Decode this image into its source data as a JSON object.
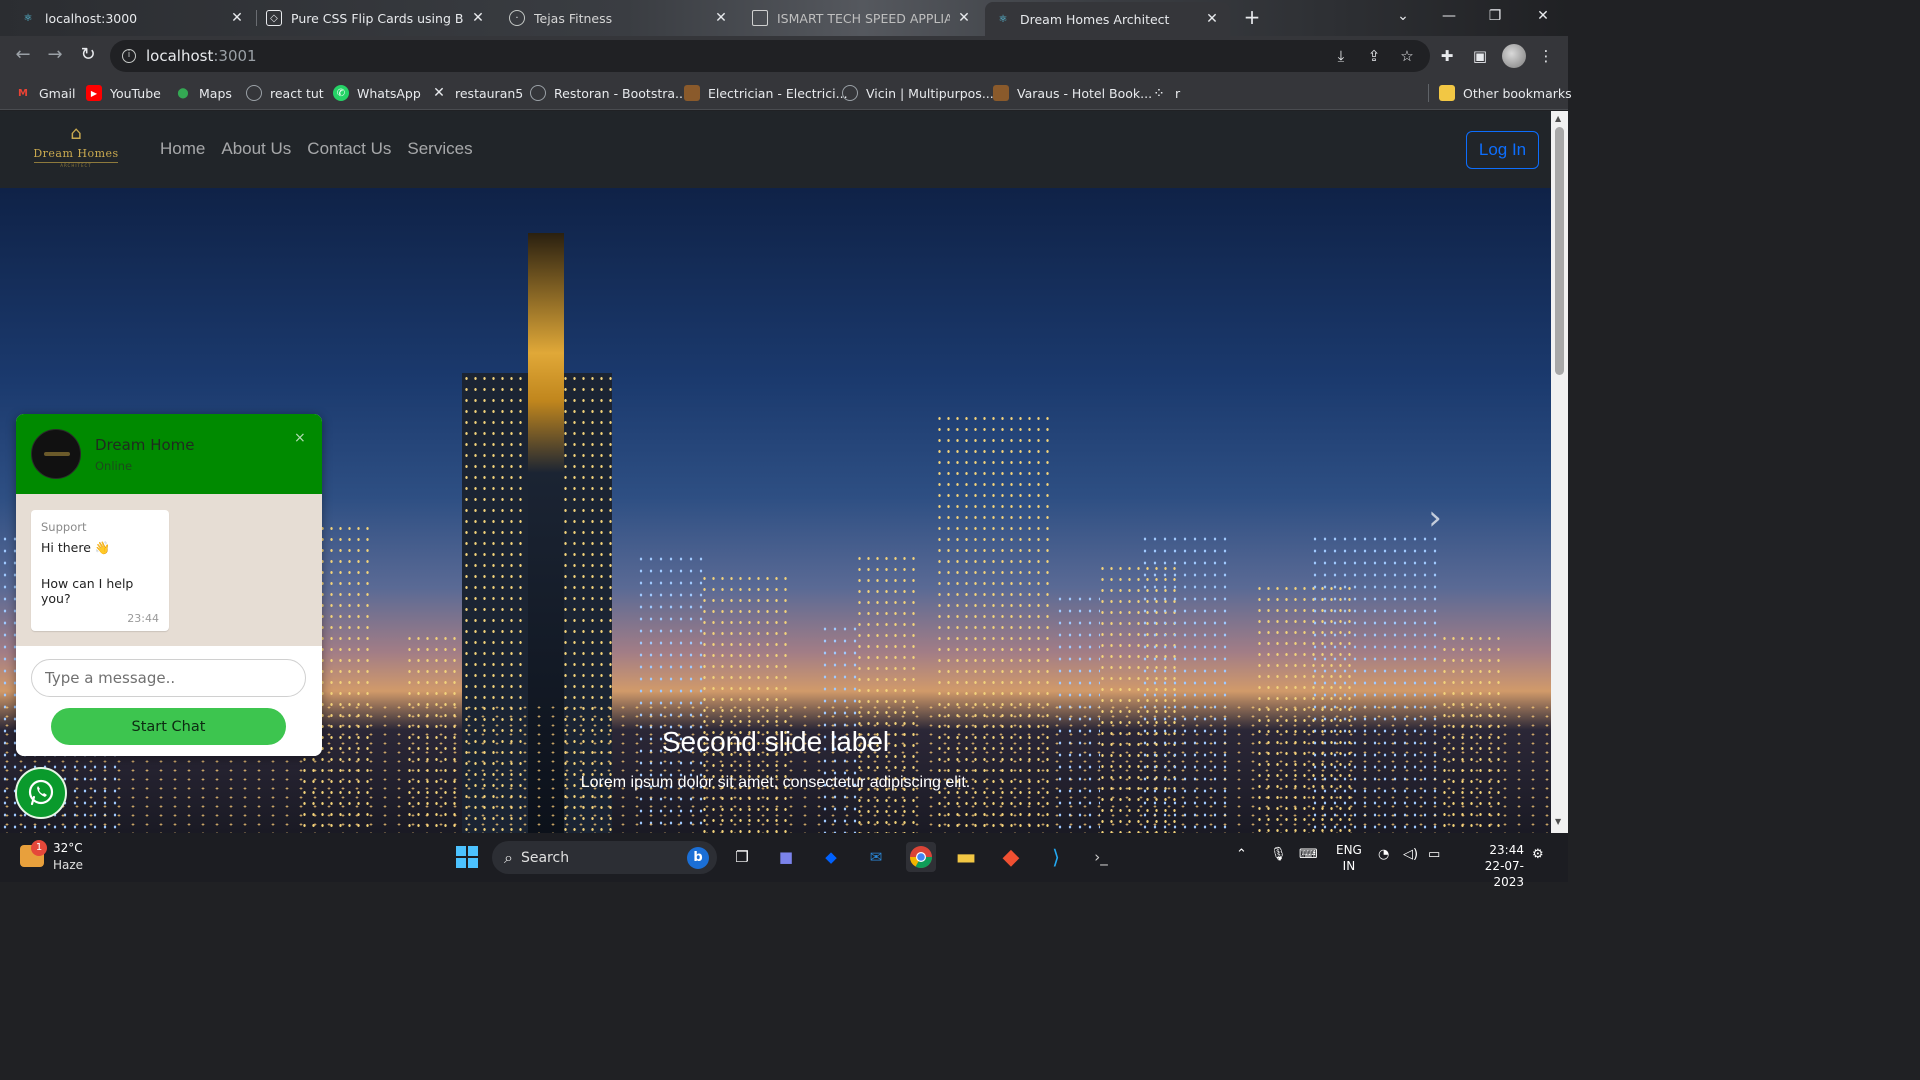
{
  "browser": {
    "tabs": [
      {
        "title": "localhost:3000",
        "favicon": "react-icon",
        "active": false
      },
      {
        "title": "Pure CSS Flip Cards using Bootst",
        "favicon": "codepen-icon",
        "active": false
      },
      {
        "title": "Tejas Fitness",
        "favicon": "globe-icon",
        "active": false
      },
      {
        "title": "ISMART TECH SPEED APPLIANCE",
        "favicon": "page-icon",
        "active": false
      },
      {
        "title": "Dream Homes Architect",
        "favicon": "react-icon",
        "active": true
      }
    ],
    "url_host": "localhost",
    "url_port": ":3001",
    "bookmarks": [
      {
        "label": "Gmail",
        "icon": "gmail-icon",
        "color": "#ea4335"
      },
      {
        "label": "YouTube",
        "icon": "youtube-icon",
        "color": "#ff0000"
      },
      {
        "label": "Maps",
        "icon": "maps-icon",
        "color": "#34a853"
      },
      {
        "label": "react tut",
        "icon": "globe-icon",
        "color": "#9aa0a6"
      },
      {
        "label": "WhatsApp",
        "icon": "whatsapp-icon",
        "color": "#25d366"
      },
      {
        "label": "restauran5",
        "icon": "cross-icon",
        "color": "#e8eaed"
      },
      {
        "label": "Restoran - Bootstra...",
        "icon": "globe-icon",
        "color": "#9aa0a6"
      },
      {
        "label": "Electrician - Electrici...",
        "icon": "page-icon",
        "color": "#8a5a2b"
      },
      {
        "label": "Vicin | Multipurpos...",
        "icon": "globe-icon",
        "color": "#9aa0a6"
      },
      {
        "label": "Varaus - Hotel Book...",
        "icon": "page-icon",
        "color": "#8a5a2b"
      },
      {
        "label": "r",
        "icon": "dots-icon",
        "color": "#e8eaed"
      }
    ],
    "other_bookmarks": "Other bookmarks"
  },
  "site": {
    "logo_text": "Dream Homes",
    "logo_sub": "ARCHITECT",
    "nav": [
      "Home",
      "About Us",
      "Contact Us",
      "Services"
    ],
    "login_label": "Log In",
    "slide_title": "Second slide label",
    "slide_text": "Lorem ipsum dolor sit amet, consectetur adipiscing elit."
  },
  "chat": {
    "name": "Dream Home",
    "status": "Online",
    "close": "×",
    "message_from": "Support",
    "message_line1": "Hi there 👋",
    "message_line2": "How can I help you?",
    "message_time": "23:44",
    "input_placeholder": "Type a message..",
    "start_label": "Start Chat",
    "header_color": "#008a00",
    "button_color": "#3dc54f"
  },
  "taskbar": {
    "weather_temp": "32°C",
    "weather_desc": "Haze",
    "weather_badge": "1",
    "search_label": "Search",
    "lang_line1": "ENG",
    "lang_line2": "IN",
    "time": "23:44",
    "date": "22-07-2023"
  }
}
